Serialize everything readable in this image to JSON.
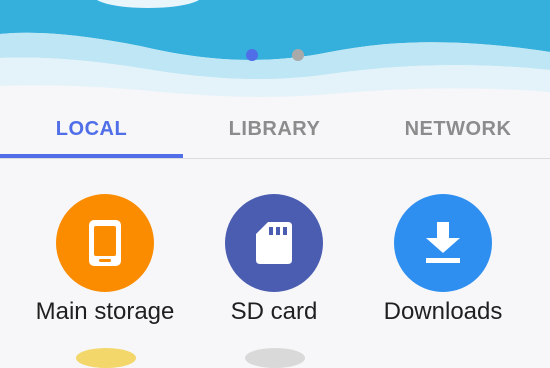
{
  "pager": {
    "page_count": 2,
    "active_index": 0
  },
  "tabs": [
    {
      "label": "LOCAL",
      "active": true
    },
    {
      "label": "LIBRARY",
      "active": false
    },
    {
      "label": "NETWORK",
      "active": false
    }
  ],
  "storage_items": [
    {
      "label": "Main storage",
      "icon": "tablet-icon",
      "color": "#fb8c00"
    },
    {
      "label": "SD card",
      "icon": "sd-card-icon",
      "color": "#4a5db0"
    },
    {
      "label": "Downloads",
      "icon": "download-icon",
      "color": "#2f8ff0"
    }
  ],
  "colors": {
    "accent": "#4f6ee8",
    "banner_blue": "#35b0dd",
    "inactive_tab": "#8c8c8c"
  }
}
